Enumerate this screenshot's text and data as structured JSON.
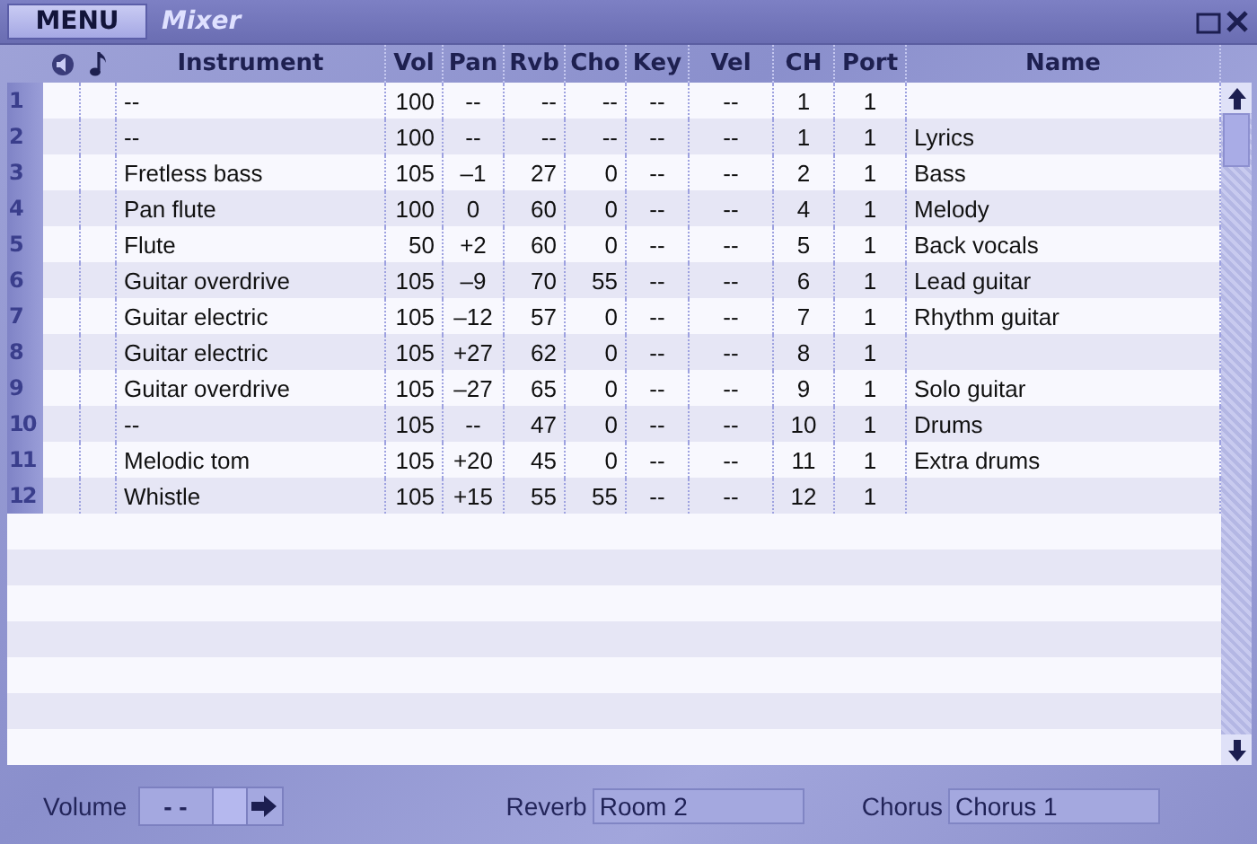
{
  "menu": "MENU",
  "window": {
    "title": "Mixer"
  },
  "table": {
    "columns": [
      "Instrument",
      "Vol",
      "Pan",
      "Rvb",
      "Cho",
      "Key",
      "Vel",
      "CH",
      "Port",
      "Name"
    ],
    "rows": [
      {
        "number": "1",
        "cells": [
          "--",
          "100",
          "--",
          "--",
          "--",
          "--",
          "--",
          "1",
          "1",
          ""
        ]
      },
      {
        "number": "2",
        "cells": [
          "--",
          "100",
          "--",
          "--",
          "--",
          "--",
          "--",
          "1",
          "1",
          "Lyrics"
        ]
      },
      {
        "number": "3",
        "cells": [
          "Fretless bass",
          "105",
          "–1",
          "27",
          "0",
          "--",
          "--",
          "2",
          "1",
          "Bass"
        ]
      },
      {
        "number": "4",
        "cells": [
          "Pan flute",
          "100",
          "0",
          "60",
          "0",
          "--",
          "--",
          "4",
          "1",
          "Melody"
        ]
      },
      {
        "number": "5",
        "cells": [
          "Flute",
          "50",
          "+2",
          "60",
          "0",
          "--",
          "--",
          "5",
          "1",
          "Back vocals"
        ]
      },
      {
        "number": "6",
        "cells": [
          "Guitar overdrive",
          "105",
          "–9",
          "70",
          "55",
          "--",
          "--",
          "6",
          "1",
          "Lead guitar"
        ]
      },
      {
        "number": "7",
        "cells": [
          "Guitar electric",
          "105",
          "–12",
          "57",
          "0",
          "--",
          "--",
          "7",
          "1",
          "Rhythm guitar"
        ]
      },
      {
        "number": "8",
        "cells": [
          "Guitar electric",
          "105",
          "+27",
          "62",
          "0",
          "--",
          "--",
          "8",
          "1",
          ""
        ]
      },
      {
        "number": "9",
        "cells": [
          "Guitar overdrive",
          "105",
          "–27",
          "65",
          "0",
          "--",
          "--",
          "9",
          "1",
          "Solo guitar"
        ]
      },
      {
        "number": "10",
        "cells": [
          "--",
          "105",
          "--",
          "47",
          "0",
          "--",
          "--",
          "10",
          "1",
          "Drums"
        ]
      },
      {
        "number": "11",
        "cells": [
          "Melodic tom",
          "105",
          "+20",
          "45",
          "0",
          "--",
          "--",
          "11",
          "1",
          "Extra drums"
        ]
      },
      {
        "number": "12",
        "cells": [
          "Whistle",
          "105",
          "+15",
          "55",
          "55",
          "--",
          "--",
          "12",
          "1",
          ""
        ]
      }
    ]
  },
  "footer": {
    "volume_label": "Volume",
    "volume_value": "- -",
    "reverb_label": "Reverb",
    "reverb_value": "Room 2",
    "chorus_label": "Chorus",
    "chorus_value": "Chorus 1"
  }
}
